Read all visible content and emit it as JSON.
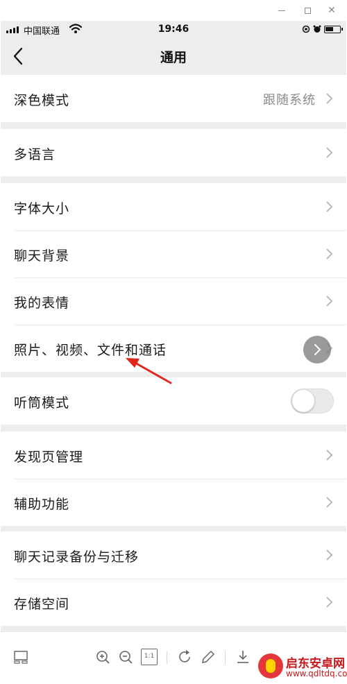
{
  "status_bar": {
    "carrier": "中国联通",
    "time": "19:46"
  },
  "nav": {
    "title": "通用"
  },
  "groups": [
    {
      "rows": [
        {
          "label": "深色模式",
          "value": "跟随系统",
          "control": "chevron-icon"
        }
      ]
    },
    {
      "rows": [
        {
          "label": "多语言",
          "control": "chevron-icon"
        }
      ]
    },
    {
      "rows": [
        {
          "label": "字体大小",
          "control": "chevron-icon"
        },
        {
          "label": "聊天背景",
          "control": "chevron-icon"
        },
        {
          "label": "我的表情",
          "control": "chevron-icon"
        },
        {
          "label": "照片、视频、文件和通话",
          "control": "chevron-icon"
        }
      ]
    },
    {
      "rows": [
        {
          "label": "听筒模式",
          "control": "toggle",
          "toggle_on": false
        }
      ]
    },
    {
      "rows": [
        {
          "label": "发现页管理",
          "control": "chevron-icon"
        },
        {
          "label": "辅助功能",
          "control": "chevron-icon"
        }
      ]
    },
    {
      "rows": [
        {
          "label": "聊天记录备份与迁移",
          "control": "chevron-icon"
        },
        {
          "label": "存储空间",
          "control": "chevron-icon"
        }
      ]
    }
  ],
  "annotation": {
    "color": "#e0251b",
    "points_to": "照片、视频、文件和通话"
  },
  "toolbar": {
    "items": [
      "thumbnail-icon",
      "zoom-in-icon",
      "zoom-out-icon",
      "actual-size-icon",
      "rotate-icon",
      "edit-icon",
      "download-icon"
    ],
    "actual_size_label": "1:1"
  },
  "watermark": {
    "name": "启东安卓网",
    "url": "www.qdltdq.com"
  },
  "colors": {
    "page_bg": "#ededed",
    "row_bg": "#ffffff",
    "secondary_text": "#8a8a8a",
    "watermark_red": "#c8161d"
  }
}
